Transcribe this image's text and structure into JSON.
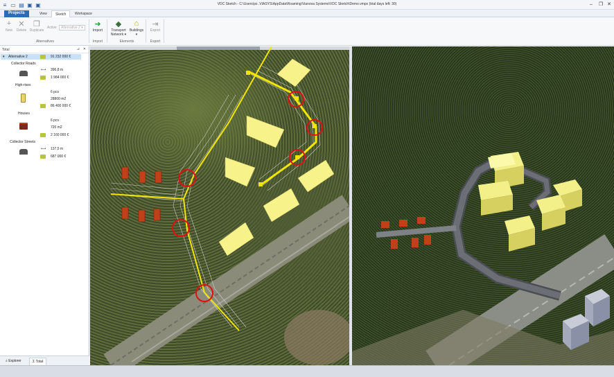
{
  "window": {
    "title": "VDC Sketch - C:\\Users\\ps .VIASYS\\AppData\\Roaming\\Vianova Systems\\VDC Sketch\\Demo.vmpx (trial days left: 30)"
  },
  "tabs": [
    {
      "label": "Projects"
    },
    {
      "label": "View"
    },
    {
      "label": "Sketch"
    },
    {
      "label": "Workspace"
    }
  ],
  "ribbon": {
    "new_label": "New",
    "delete_label": "Delete",
    "duplicate_label": "Duplicate",
    "active_label": "Active",
    "active_value": "Alternative 2",
    "alternatives_group": "Alternatives",
    "import_label": "Import",
    "import_group": "Import",
    "transport_label": "Transport",
    "transport_label2": "Network",
    "buildings_label": "Buildings",
    "elements_group": "Elements",
    "export_label": "Export",
    "export_group": "Export"
  },
  "panel": {
    "title": "Total",
    "alternative": {
      "name": "Alternative 2",
      "cost": "91 232 000 €"
    },
    "sections": [
      {
        "name": "Collector Roads",
        "length": "396,8 m",
        "cost": "1 984 000 €"
      },
      {
        "name": "High-rises",
        "count": "6 pcs",
        "area": "28800 m2",
        "cost": "86 400 000 €"
      },
      {
        "name": "Houses",
        "count": "6 pcs",
        "area": "720 m2",
        "cost": "2 160 000 €"
      },
      {
        "name": "Collector Streets",
        "length": "137,5 m",
        "cost": "687 000 €"
      }
    ],
    "bottom_tabs": [
      {
        "label": "Explorer"
      },
      {
        "label": "Total"
      }
    ]
  },
  "colors": {
    "accent": "#2e6bb5",
    "road_yellow": "#f2e600",
    "building": "#f7f28a",
    "house": "#c0401a",
    "circle": "#e01010"
  }
}
